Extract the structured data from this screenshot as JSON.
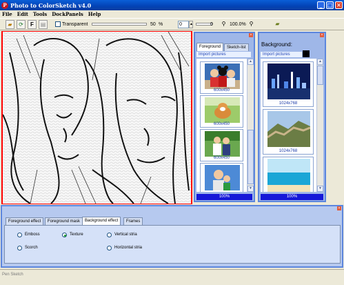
{
  "window": {
    "title": "Photo to ColorSketch v4.0",
    "app_icon_glyph": "P"
  },
  "menu": [
    "File",
    "Edit",
    "Tools",
    "DockPanels",
    "Help"
  ],
  "toolbar": {
    "transparent_label": "Transparent",
    "percent_value": "50",
    "percent_unit": "%",
    "rotate_value": "0",
    "offset_value": "0",
    "zoom_value": "100.0%"
  },
  "foreground_panel": {
    "tabs": [
      "Foreground",
      "Sketch-list"
    ],
    "import_label": "Import pictures",
    "thumbnails": [
      {
        "caption": "600x450",
        "icon": "couple-with-mickey-photo"
      },
      {
        "caption": "600x450",
        "icon": "dog-on-grass-photo"
      },
      {
        "caption": "600x450",
        "icon": "couple-in-park-photo"
      },
      {
        "caption": "",
        "icon": "man-and-child-photo"
      }
    ],
    "progress": "100%",
    "progress_fraction": 1.0
  },
  "background_panel": {
    "header": "Background:",
    "import_label": "Import pictures",
    "thumbnails": [
      {
        "caption": "1024x768",
        "icon": "city-night-skyline-photo"
      },
      {
        "caption": "1024x768",
        "icon": "great-wall-photo"
      },
      {
        "caption": "",
        "icon": "ocean-beach-photo"
      }
    ],
    "progress": "100%",
    "progress_fraction": 1.0
  },
  "effects": {
    "tabs": [
      "Foreground effect",
      "Foreground mask",
      "Background effect",
      "Frames"
    ],
    "active_tab_index": 2,
    "options": [
      "Emboss",
      "Texture",
      "Vertical stria",
      "Scorch",
      "Horizontal stria"
    ],
    "selected_option": "Texture"
  },
  "status": {
    "text": "Pen Sketch"
  },
  "colors": {
    "title_bar": "#0342b5",
    "panel_border": "#5c86de",
    "progress": "#1518d8",
    "canvas_border": "#ff0000"
  }
}
